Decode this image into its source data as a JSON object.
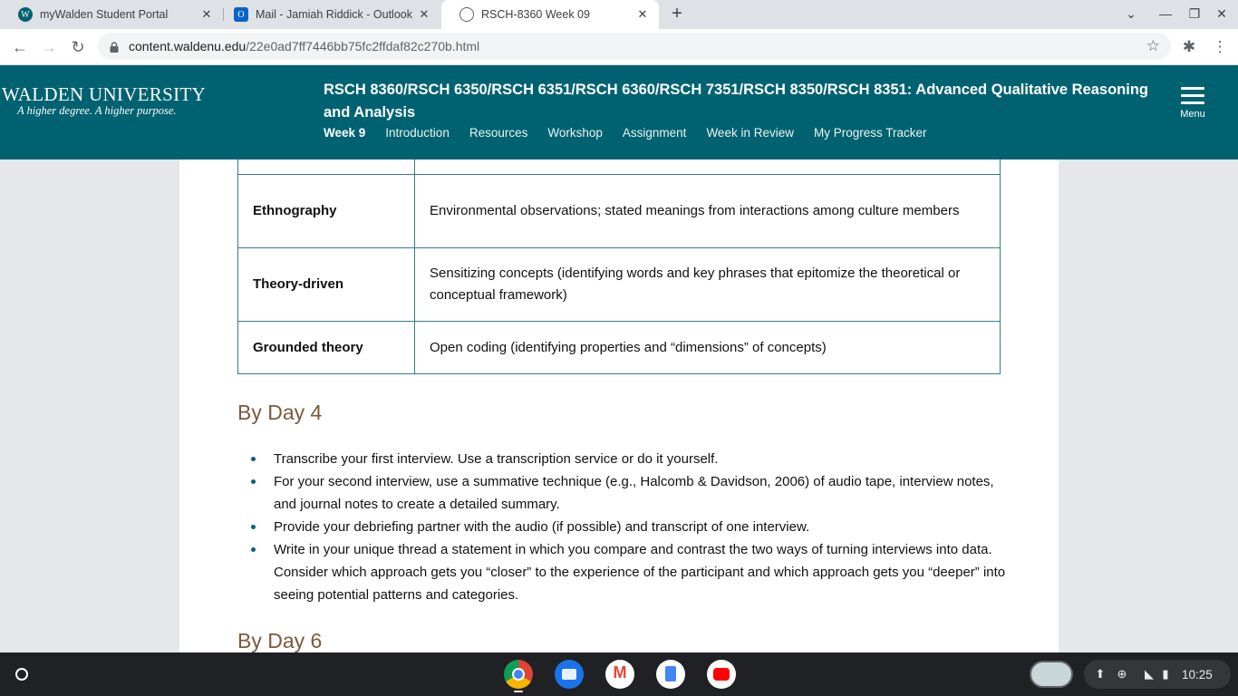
{
  "browser": {
    "tabs": [
      {
        "title": "myWalden Student Portal",
        "icon": "walden-favicon-icon",
        "active": false
      },
      {
        "title": "Mail - Jamiah Riddick - Outlook",
        "icon": "outlook-icon",
        "active": false
      },
      {
        "title": "RSCH-8360 Week 09",
        "icon": "globe-icon",
        "active": true
      }
    ],
    "url_host": "content.waldenu.edu",
    "url_path": "/22e0ad7ff7446bb75fc2ffdaf82c270b.html"
  },
  "site": {
    "logo_name": "WALDEN UNIVERSITY",
    "logo_tagline": "A higher degree. A higher purpose.",
    "course_title": "RSCH 8360/RSCH 6350/RSCH 6351/RSCH 6360/RSCH 7351/RSCH 8350/RSCH 8351: Advanced Qualitative Reasoning and Analysis",
    "nav": [
      "Week 9",
      "Introduction",
      "Resources",
      "Workshop",
      "Assignment",
      "Week in Review",
      "My Progress Tracker"
    ],
    "menu_label": "Menu",
    "brand_color": "#006271"
  },
  "content": {
    "table_rows": [
      {
        "approach": "",
        "method": ""
      },
      {
        "approach": "Ethnography",
        "method": "Environmental observations; stated meanings from interactions among culture members"
      },
      {
        "approach": "Theory-driven",
        "method": "Sensitizing concepts (identifying words and key phrases that epitomize the theoretical or conceptual framework)"
      },
      {
        "approach": "Grounded theory",
        "method": "Open coding (identifying properties and “dimensions” of concepts)"
      }
    ],
    "day4_heading": "By Day 4",
    "day4_items": [
      "Transcribe your first interview. Use a transcription service or do it yourself.",
      "For your second interview, use a summative technique (e.g., Halcomb & Davidson, 2006) of audio tape, interview notes, and journal notes to create a detailed summary.",
      "Provide your debriefing partner with the audio (if possible) and transcript of one interview.",
      "Write in your unique thread a statement in which you compare and contrast the two ways of turning interviews into data. Consider which approach gets you “closer” to the experience of the participant and which approach gets you “deeper” into seeing potential patterns and categories."
    ],
    "day6_heading": "By Day 6"
  },
  "shelf": {
    "time": "10:25"
  }
}
